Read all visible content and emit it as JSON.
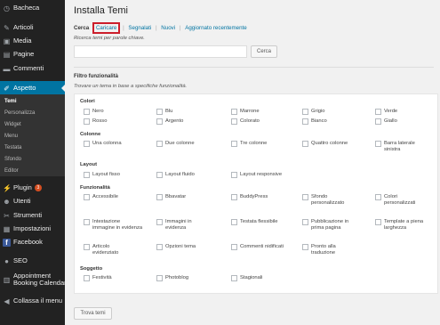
{
  "sidebar": {
    "items": [
      {
        "label": "Bacheca",
        "icon": "dashboard-icon",
        "glyph": "◷"
      },
      {
        "label": "Articoli",
        "icon": "pin-icon",
        "glyph": "✎"
      },
      {
        "label": "Media",
        "icon": "media-icon",
        "glyph": "▣"
      },
      {
        "label": "Pagine",
        "icon": "page-icon",
        "glyph": "▤"
      },
      {
        "label": "Commenti",
        "icon": "comment-icon",
        "glyph": "▬"
      },
      {
        "label": "Aspetto",
        "icon": "brush-icon",
        "glyph": "✐"
      }
    ],
    "aspetto_sub": [
      "Temi",
      "Personalizza",
      "Widget",
      "Menu",
      "Testata",
      "Sfondo",
      "Editor"
    ],
    "lower": [
      {
        "label": "Plugin",
        "badge": "3",
        "icon": "plugin-icon",
        "glyph": "⚡"
      },
      {
        "label": "Utenti",
        "icon": "users-icon",
        "glyph": "☻"
      },
      {
        "label": "Strumenti",
        "icon": "tools-icon",
        "glyph": "✂"
      },
      {
        "label": "Impostazioni",
        "icon": "settings-icon",
        "glyph": "▦"
      },
      {
        "label": "Facebook",
        "icon": "facebook-icon",
        "glyph": "f"
      },
      {
        "label": "SEO",
        "icon": "seo-icon",
        "glyph": "●"
      },
      {
        "label": "Appointment",
        "label2": "Booking Calendar",
        "icon": "calendar-icon",
        "glyph": "▥"
      },
      {
        "label": "Collassa il menu",
        "icon": "collapse-icon",
        "glyph": "◀"
      }
    ]
  },
  "page": {
    "title": "Installa Temi",
    "tabs": [
      {
        "label": "Cerca"
      },
      {
        "label": "Caricare"
      },
      {
        "label": "Segnalati"
      },
      {
        "label": "Nuovi"
      },
      {
        "label": "Aggiornato recentemente"
      }
    ],
    "search_hint": "Ricerca temi per parole chiave.",
    "search_button": "Cerca",
    "filter_heading": "Filtro funzionalità",
    "filter_desc": "Trovare un tema in base a specifiche funzionalità.",
    "find_button": "Trova temi"
  },
  "filters": {
    "colori": {
      "title": "Colori",
      "options": [
        "Nero",
        "Blu",
        "Marrone",
        "Grigio",
        "Verde",
        "Rosso",
        "Argento",
        "Colorato",
        "Bianco",
        "Giallo"
      ]
    },
    "colonne": {
      "title": "Colonne",
      "options": [
        "Una colonna",
        "Due colonne",
        "Tre colonne",
        "Quattro colonne",
        "Barra laterale",
        "sinistra"
      ]
    },
    "layout": {
      "title": "Layout",
      "options": [
        "Layout fisso",
        "Layout fluido",
        "Layout responsive"
      ]
    },
    "funzionalita": {
      "title": "Funzionalità",
      "options": [
        "Accessibile",
        "Bbavatar",
        "BuddyPress",
        "Sfondo",
        "personalizzato",
        "Colori",
        "personalizzati",
        "Intestazione",
        "immagine in evidenza",
        "Immagini in",
        "evidenza",
        "Testata flessibile",
        "Pubblicazione in",
        "prima pagina",
        "Template a piena",
        "larghezza",
        "Articolo",
        "evidenziato",
        "Opzioni tema",
        "Commenti nidificati",
        "Pronto alla",
        "traduzione"
      ]
    },
    "soggetto": {
      "title": "Soggetto",
      "options": [
        "Festività",
        "Photoblog",
        "Stagionali"
      ]
    }
  },
  "colors": {
    "sidebar_bg": "#222222",
    "active_bg": "#0074a2",
    "link": "#0074a2",
    "highlight_box": "#cc1e2b"
  }
}
